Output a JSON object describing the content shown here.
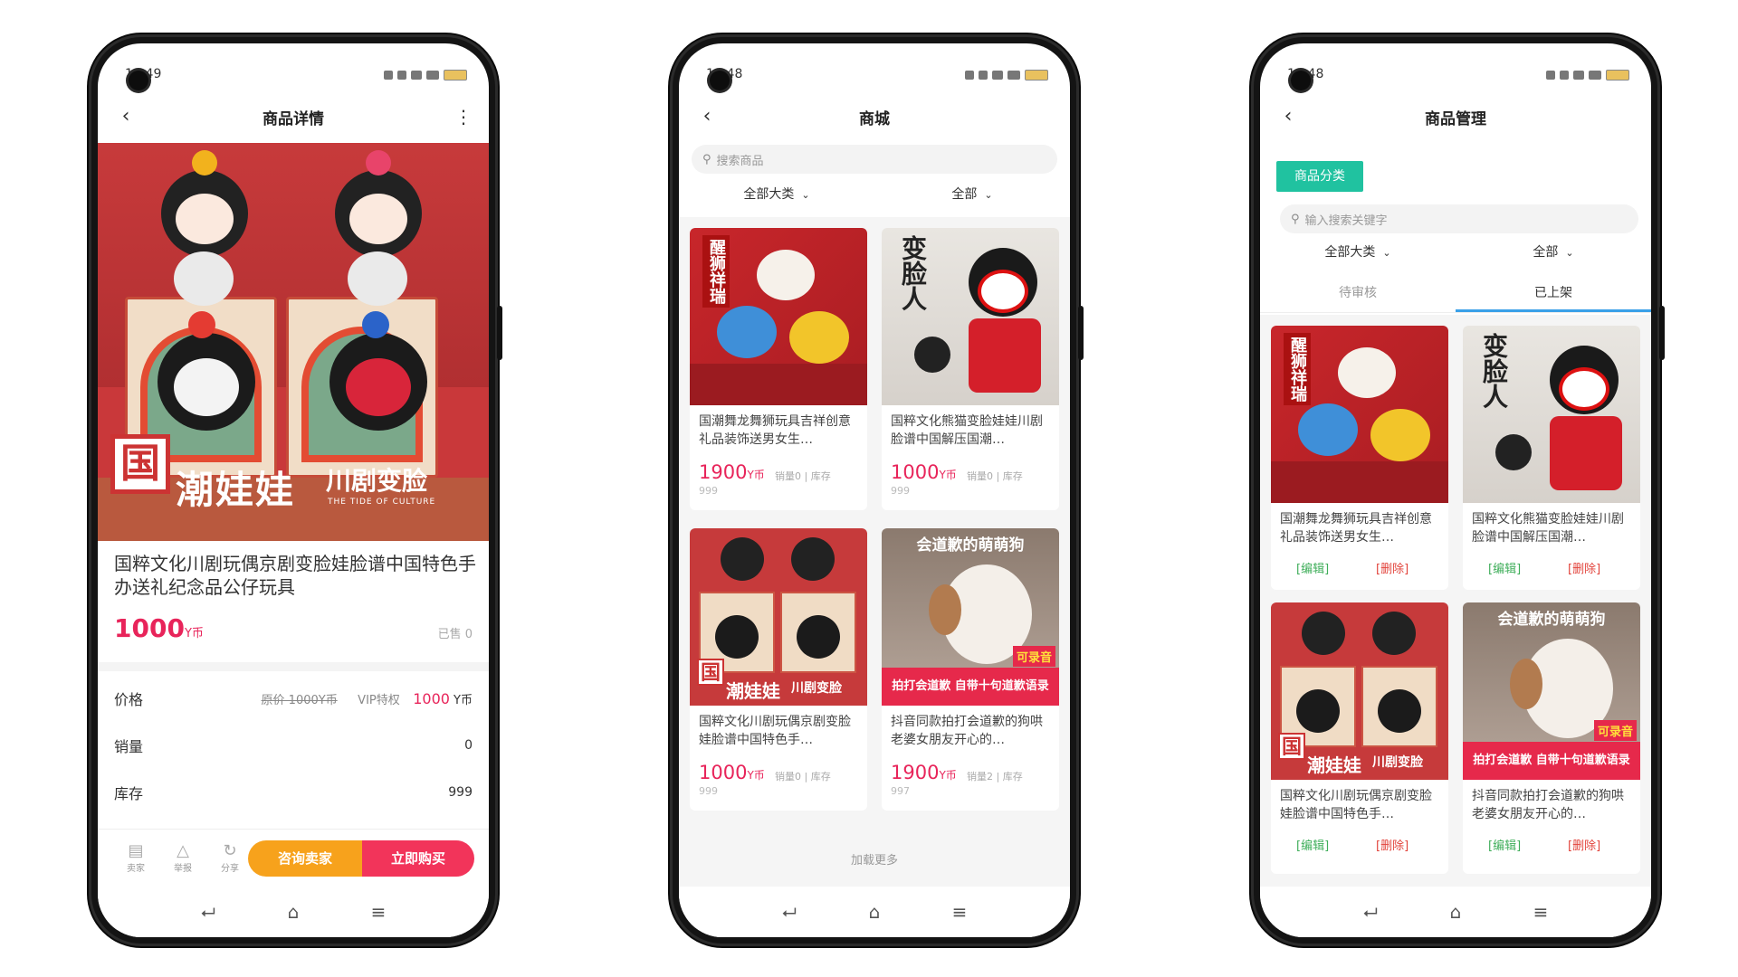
{
  "status": {
    "time1": "11:49",
    "time2": "11:48",
    "time3": "11:48"
  },
  "phone1": {
    "nav_title": "商品详情",
    "hero": {
      "guo": "国",
      "slogan": "潮娃娃",
      "slogan2": "川剧变脸",
      "slogan3": "THE TIDE OF CULTURE"
    },
    "title": "国粹文化川剧玩偶京剧变脸娃脸谱中国特色手办送礼纪念品公仔玩具",
    "price": "1000",
    "price_unit": "Y币",
    "sold": "已售 0",
    "rows": {
      "price_label": "价格",
      "orig_price": "原价 1000Y币",
      "vip_label": "VIP特权",
      "vip_price": "1000",
      "vip_unit": " Y币",
      "sales_label": "销量",
      "sales_value": "0",
      "stock_label": "库存",
      "stock_value": "999"
    },
    "bottom": {
      "seller": "卖家",
      "report": "举报",
      "share": "分享",
      "consult": "咨询卖家",
      "buy": "立即购买"
    }
  },
  "phone2": {
    "nav_title": "商城",
    "search_placeholder": "搜索商品",
    "filter_category": "全部大类",
    "filter_all": "全部",
    "products": [
      {
        "name": "国潮舞龙舞狮玩具吉祥创意礼品装饰送男女生…",
        "price": "1900",
        "unit": "Y币",
        "meta": "销量0 | 库存",
        "stock": "999"
      },
      {
        "name": "国粹文化熊猫变脸娃娃川剧脸谱中国解压国潮…",
        "price": "1000",
        "unit": "Y币",
        "meta": "销量0 | 库存",
        "stock": "999"
      },
      {
        "name": "国粹文化川剧玩偶京剧变脸娃脸谱中国特色手…",
        "price": "1000",
        "unit": "Y币",
        "meta": "销量0 | 库存",
        "stock": "999"
      },
      {
        "name": "抖音同款拍打会道歉的狗哄老婆女朋友开心的…",
        "price": "1900",
        "unit": "Y币",
        "meta": "销量2 | 库存",
        "stock": "997"
      }
    ],
    "load_more": "加载更多"
  },
  "phone3": {
    "nav_title": "商品管理",
    "category_button": "商品分类",
    "search_placeholder": "输入搜索关键字",
    "filter_category": "全部大类",
    "filter_all": "全部",
    "tabs": [
      "待审核",
      "已上架"
    ],
    "products": [
      {
        "name": "国潮舞龙舞狮玩具吉祥创意礼品装饰送男女生…"
      },
      {
        "name": "国粹文化熊猫变脸娃娃川剧脸谱中国解压国潮…"
      },
      {
        "name": "国粹文化川剧玩偶京剧变脸娃脸谱中国特色手…"
      },
      {
        "name": "抖音同款拍打会道歉的狗哄老婆女朋友开心的…"
      }
    ],
    "edit_label": "[编辑]",
    "delete_label": "[删除]"
  },
  "art": {
    "lion_vertical": "醒狮祥瑞",
    "mask_vertical": "变脸人",
    "opera_guo": "国",
    "opera_slogan": "潮娃娃",
    "opera_slogan2": "川剧变脸",
    "dog_top": "会道歉的萌萌狗",
    "dog_banner1": "拍打会道歉",
    "dog_banner2": "自带十句道歉语录",
    "dog_badge": "可录音"
  },
  "colors": {
    "accent_pink": "#e8245a",
    "accent_orange": "#f7a21c",
    "teal": "#20c2a0",
    "tab_blue": "#3aa0e8"
  }
}
